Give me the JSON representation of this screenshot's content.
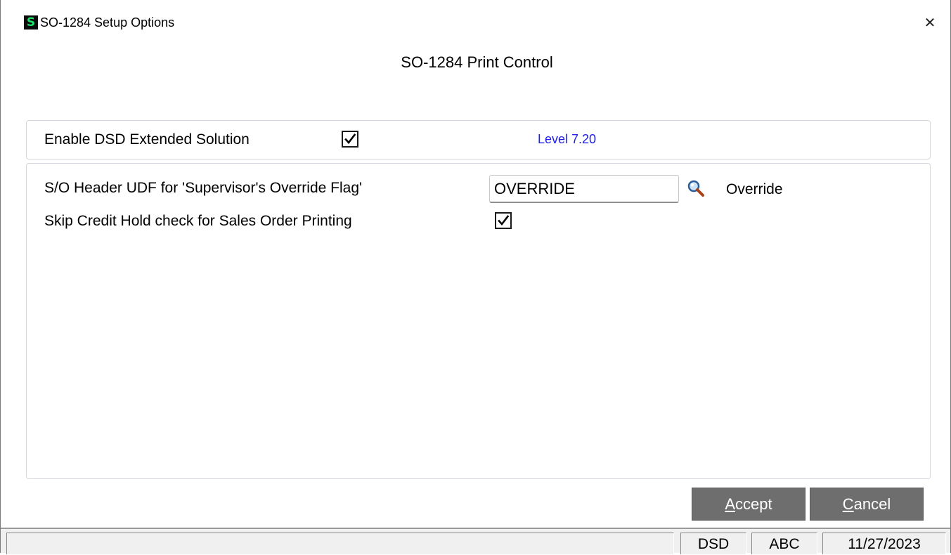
{
  "window": {
    "title": "SO-1284 Setup Options",
    "app_icon_letter": "S",
    "close_glyph": "✕"
  },
  "heading": "SO-1284 Print Control",
  "top_panel": {
    "enable_label": "Enable DSD Extended Solution",
    "enable_checked": true,
    "level_text": "Level 7.20"
  },
  "main_panel": {
    "udf_label": "S/O Header UDF for 'Supervisor's Override Flag'",
    "udf_value": "OVERRIDE",
    "udf_description": "Override",
    "lookup_icon": "magnifier-icon",
    "skip_label": "Skip Credit Hold check for Sales Order Printing",
    "skip_checked": true
  },
  "buttons": {
    "accept_mnemonic": "A",
    "accept_rest": "ccept",
    "cancel_mnemonic": "C",
    "cancel_rest": "ancel"
  },
  "status_bar": {
    "main": "",
    "cell1": "DSD",
    "cell2": "ABC",
    "date": "11/27/2023"
  },
  "colors": {
    "level_text": "#2020e8",
    "button_bg": "#6e6e6e",
    "app_icon_fg": "#19e36a"
  }
}
